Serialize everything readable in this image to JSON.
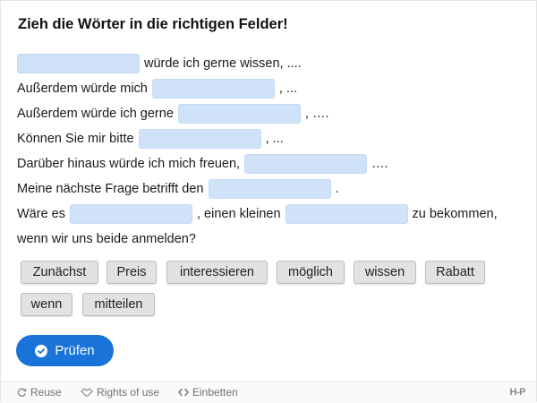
{
  "task": {
    "title": "Zieh die Wörter in die richtigen Felder!"
  },
  "sentences": {
    "l1_after": "würde ich gerne wissen, ....",
    "l2_before": "Außerdem würde mich",
    "l2_after": ", ...",
    "l3_before": "Außerdem würde ich gerne",
    "l3_after": ", ….",
    "l4_before": "Können Sie mir bitte",
    "l4_after": ", ...",
    "l5_before": "Darüber hinaus würde ich mich freuen,",
    "l5_after": "….",
    "l6_before": "Meine nächste Frage betrifft den",
    "l6_after": ".",
    "l7_before": "Wäre es",
    "l7_middle": ", einen kleinen",
    "l7_after": "zu bekommen,",
    "l8_text": "wenn wir uns beide anmelden?"
  },
  "words": [
    "Zunächst",
    "Preis",
    "interessieren",
    "möglich",
    "wissen",
    "Rabatt",
    "wenn",
    "mitteilen"
  ],
  "check_button": {
    "label": "Prüfen"
  },
  "footer": {
    "reuse": "Reuse",
    "rights": "Rights of use",
    "embed": "Einbetten",
    "logo": "H-P"
  },
  "colors": {
    "accent": "#1a73d9",
    "gap_fill": "#cfe2f7",
    "word_chip": "#e2e2e2"
  }
}
